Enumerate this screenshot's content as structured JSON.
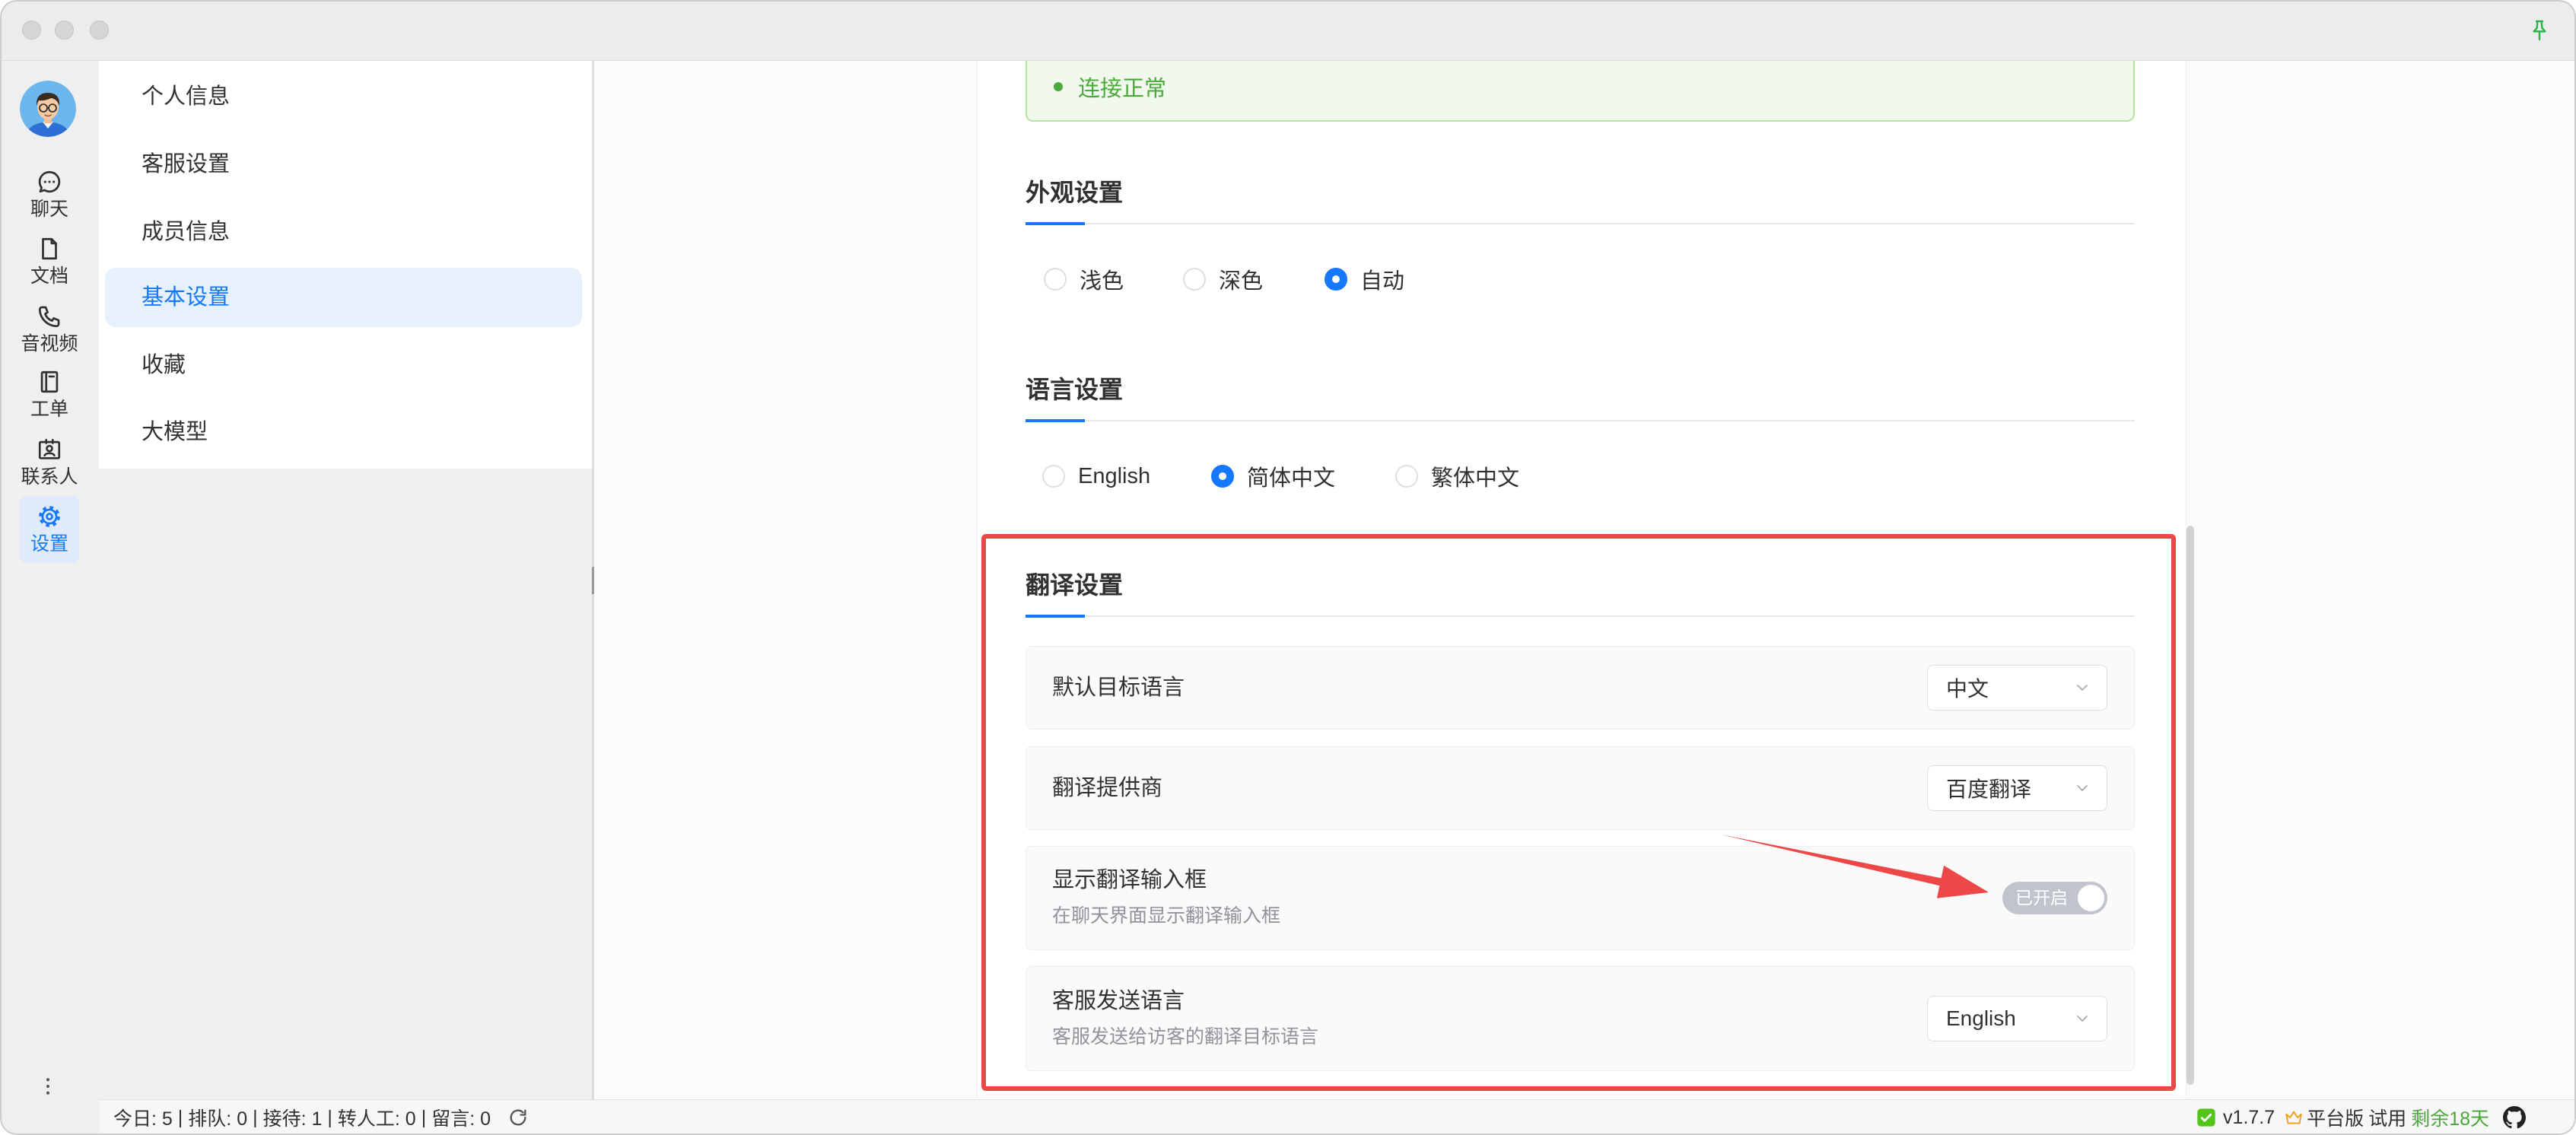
{
  "window": {
    "pin_icon": "pin-icon"
  },
  "user": {
    "avatar_icon": "avatar"
  },
  "nav": {
    "items": [
      {
        "label": "聊天",
        "icon": "chat-icon",
        "active": false
      },
      {
        "label": "文档",
        "icon": "document-icon",
        "active": false
      },
      {
        "label": "音视频",
        "icon": "phone-icon",
        "active": false
      },
      {
        "label": "工单",
        "icon": "ticket-icon",
        "active": false
      },
      {
        "label": "联系人",
        "icon": "contacts-icon",
        "active": false
      },
      {
        "label": "设置",
        "icon": "gear-icon",
        "active": true
      }
    ],
    "more_icon": "more-vertical-icon"
  },
  "settings_menu": {
    "items": [
      {
        "label": "个人信息",
        "active": false
      },
      {
        "label": "客服设置",
        "active": false
      },
      {
        "label": "成员信息",
        "active": false
      },
      {
        "label": "基本设置",
        "active": true
      },
      {
        "label": "收藏",
        "active": false
      },
      {
        "label": "大模型",
        "active": false
      }
    ]
  },
  "connection": {
    "status": "连接正常"
  },
  "appearance": {
    "title": "外观设置",
    "options": [
      {
        "label": "浅色",
        "checked": false
      },
      {
        "label": "深色",
        "checked": false
      },
      {
        "label": "自动",
        "checked": true
      }
    ]
  },
  "language": {
    "title": "语言设置",
    "options": [
      {
        "label": "English",
        "checked": false
      },
      {
        "label": "简体中文",
        "checked": true
      },
      {
        "label": "繁体中文",
        "checked": false
      }
    ]
  },
  "translation": {
    "title": "翻译设置",
    "default_target_language": {
      "label": "默认目标语言",
      "value": "中文"
    },
    "provider": {
      "label": "翻译提供商",
      "value": "百度翻译"
    },
    "show_input": {
      "label": "显示翻译输入框",
      "description": "在聊天界面显示翻译输入框",
      "enabled": true,
      "state_text": "已开启"
    },
    "agent_send_language": {
      "label": "客服发送语言",
      "description": "客服发送给访客的翻译目标语言",
      "value": "English"
    }
  },
  "statusbar": {
    "stats": [
      "今日: 5",
      "排队: 0",
      "接待: 1",
      "转人工: 0",
      "留言: 0"
    ],
    "separator": "|",
    "refresh_icon": "refresh-icon",
    "status_icon": "check-icon",
    "version": "v1.7.7",
    "edition_icon": "crown-icon",
    "edition": "平台版",
    "trial": "试用",
    "remaining": "剩余18天",
    "github_icon": "github-icon"
  },
  "colors": {
    "accent": "#1677ff",
    "success": "#4aa93a",
    "pin": "#2bb24c",
    "toggle": "#c0c4cc",
    "crown": "#f0a020",
    "annotation": "#ee4747"
  }
}
